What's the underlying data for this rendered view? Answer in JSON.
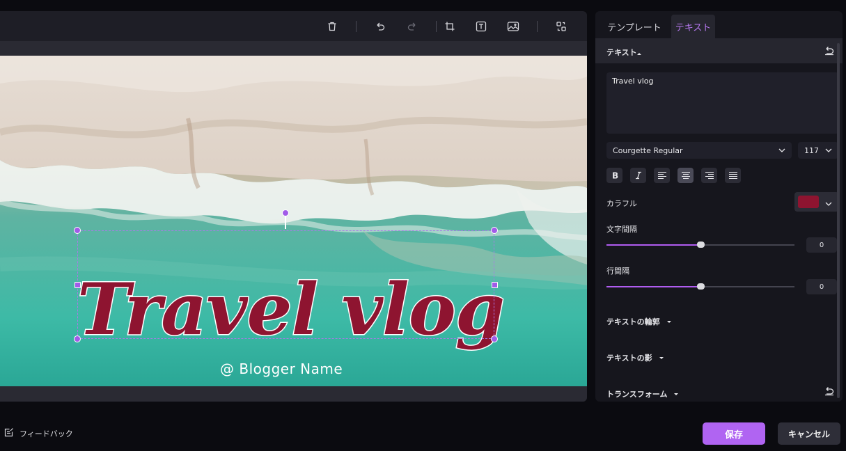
{
  "tabs": [
    {
      "label": "テンプレート"
    },
    {
      "label": "テキスト"
    }
  ],
  "canvas": {
    "title_text": "Travel vlog",
    "subtitle_text": "@ Blogger Name"
  },
  "panel": {
    "section_title": "テキスト",
    "text_value": "Travel vlog",
    "font_name": "Courgette Regular",
    "font_size": "117",
    "color_label": "カラフル",
    "color_value": "#8e1430",
    "letter_spacing_label": "文字間隔",
    "letter_spacing_value": "0",
    "letter_spacing_level": 0.5,
    "line_spacing_label": "行間隔",
    "line_spacing_value": "0",
    "line_spacing_level": 0.5,
    "outline_label": "テキストの輪郭",
    "shadow_label": "テキストの影",
    "transform_label": "トランスフォーム"
  },
  "footer": {
    "feedback_label": "フィードバック",
    "save_label": "保存",
    "cancel_label": "キャンセル"
  },
  "colors": {
    "accent": "#b064f2",
    "text_fill": "#8e1430"
  }
}
